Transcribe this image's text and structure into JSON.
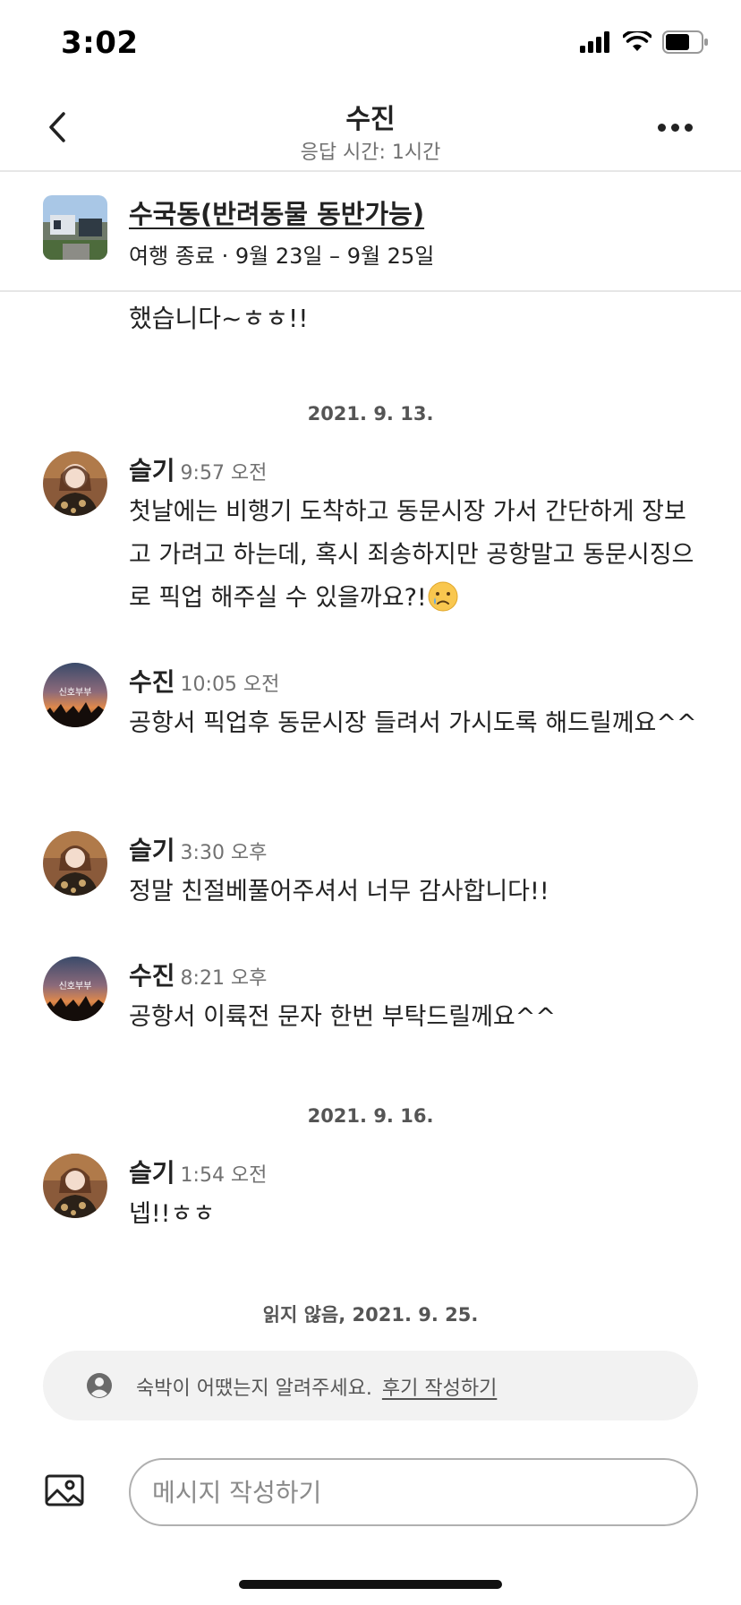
{
  "status_bar": {
    "time": "3:02"
  },
  "header": {
    "title": "수진",
    "subtitle": "응답 시간: 1시간"
  },
  "listing": {
    "name": "수국동(반려동물 동반가능)",
    "dates": "여행 종료 · 9월 23일 – 9월 25일"
  },
  "thread": {
    "partial_text": "했습니다~ㅎㅎ!!",
    "date_1": "2021. 9. 13.",
    "messages": [
      {
        "name": "슬기",
        "time": "9:57 오전",
        "text": "첫날에는 비행기 도착하고 동문시장 가서 간단하게 장보고 가려고 하는데, 혹시 죄송하지만 공항말고 동문시징으로 픽업 해주실 수 있을까요?!",
        "emoji": "crying-face"
      },
      {
        "name": "수진",
        "time": "10:05 오전",
        "text": "공항서 픽업후 동문시장 들려서 가시도록 해드릴께요^^"
      },
      {
        "name": "슬기",
        "time": "3:30 오후",
        "text": "정말 친절베풀어주셔서 너무 감사합니다!!"
      },
      {
        "name": "수진",
        "time": "8:21 오후",
        "text": "공항서 이륙전 문자 한번 부탁드릴께요^^"
      },
      {
        "name": "슬기",
        "time": "1:54 오전",
        "text": "넵!!ㅎㅎ"
      }
    ],
    "date_2": "2021. 9. 16.",
    "unread_note": "읽지 않음, 2021. 9. 25."
  },
  "review_prompt": {
    "text": "숙박이 어땠는지 알려주세요.",
    "link": "후기 작성하기"
  },
  "composer": {
    "placeholder": "메시지 작성하기",
    "value": ""
  },
  "colors": {
    "text_primary": "#222222",
    "text_secondary": "#717171",
    "divider": "#e6e6e6",
    "review_bg": "#f2f2f2"
  },
  "icons": [
    "back-chevron-icon",
    "more-dots-icon",
    "signal-icon",
    "wifi-icon",
    "battery-icon",
    "user-circle-icon",
    "image-icon"
  ]
}
